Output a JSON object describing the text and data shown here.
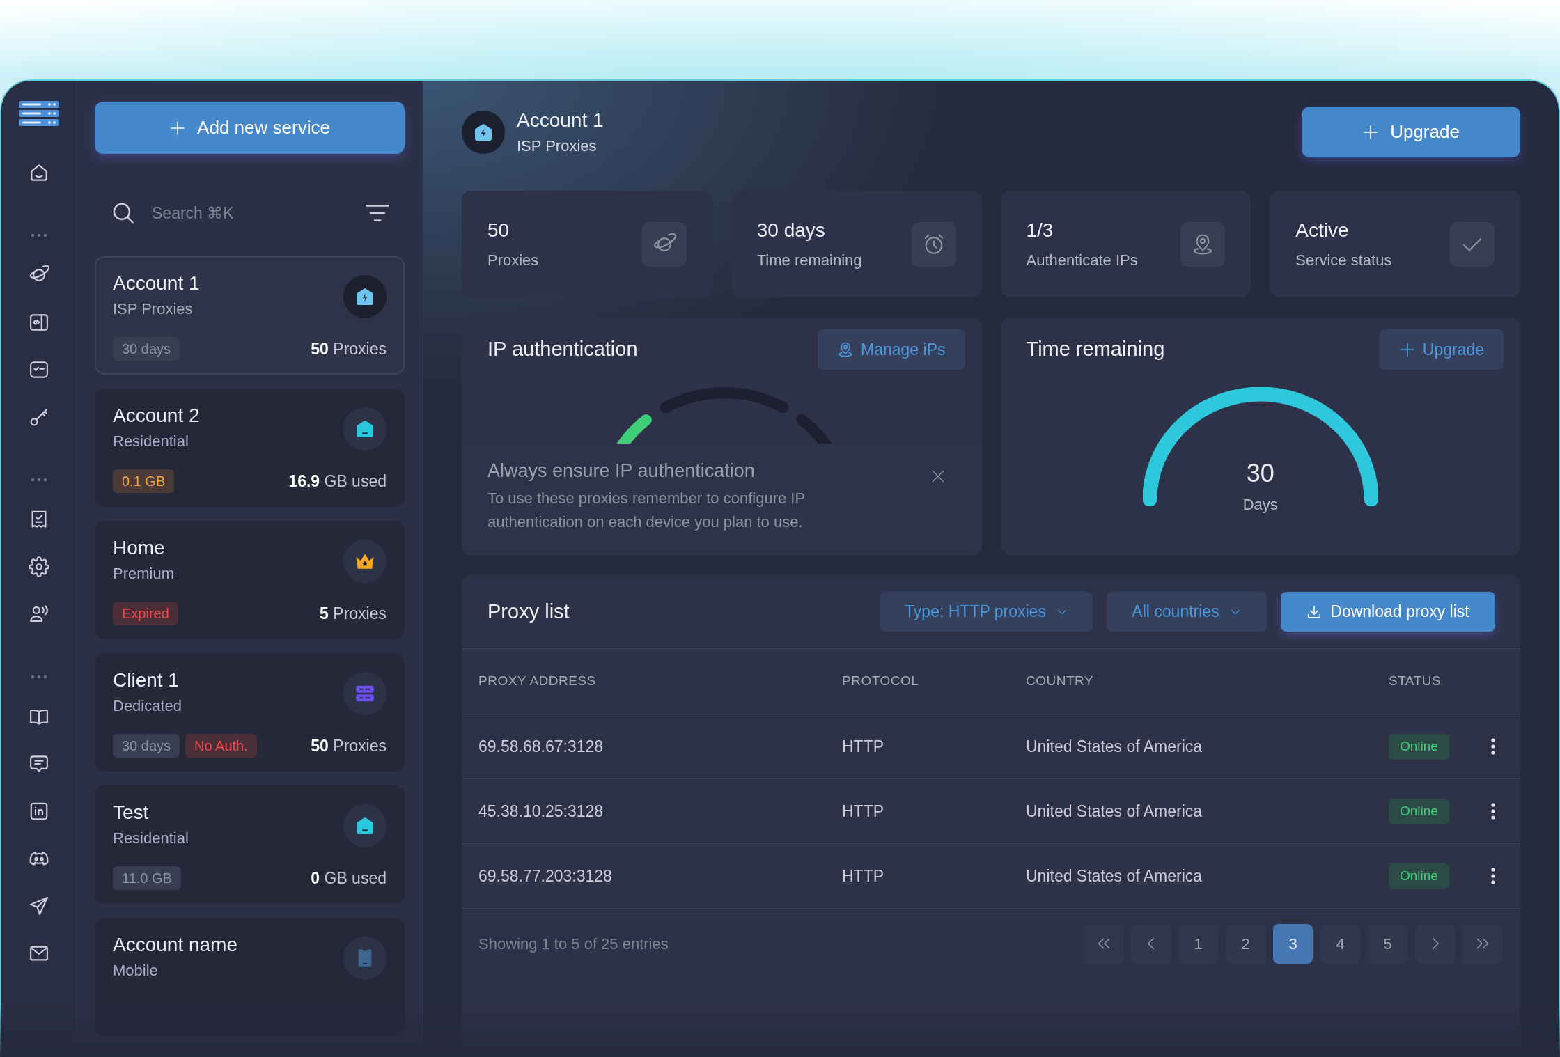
{
  "sidebar": {
    "add_button": {
      "label": "Add new service"
    },
    "search": {
      "placeholder": "Search ⌘K"
    },
    "services": [
      {
        "kind": "isp",
        "title": "Account 1",
        "subtitle": "ISP Proxies",
        "selected": true,
        "badges": [
          {
            "text": "30 days",
            "kind": "neutral"
          }
        ],
        "usage": "**50** Proxies"
      },
      {
        "kind": "residential",
        "title": "Account 2",
        "subtitle": "Residential",
        "selected": false,
        "badges": [
          {
            "text": "0.1 GB",
            "kind": "warning"
          }
        ],
        "usage": "**16.9** GB used"
      },
      {
        "kind": "premium",
        "title": "Home",
        "subtitle": "Premium",
        "selected": false,
        "badges": [
          {
            "text": "Expired",
            "kind": "danger"
          }
        ],
        "usage": "**5** Proxies"
      },
      {
        "kind": "dedicated",
        "title": "Client 1",
        "subtitle": "Dedicated",
        "selected": false,
        "badges": [
          {
            "text": "30 days",
            "kind": "neutral"
          },
          {
            "text": "No Auth.",
            "kind": "danger"
          }
        ],
        "usage": "**50** Proxies"
      },
      {
        "kind": "residential",
        "title": "Test",
        "subtitle": "Residential",
        "selected": false,
        "badges": [
          {
            "text": "11.0 GB",
            "kind": "neutral"
          }
        ],
        "usage": "**0** GB used"
      },
      {
        "kind": "mobile",
        "title": "Account name",
        "subtitle": "Mobile",
        "selected": false
      }
    ]
  },
  "header": {
    "kind": "isp",
    "title": "Account 1",
    "subtitle": "ISP Proxies",
    "upgrade_button": {
      "label": "Upgrade"
    }
  },
  "stats": [
    {
      "kind": "proxies",
      "value": "50",
      "label": "Proxies"
    },
    {
      "kind": "time",
      "value": "30 days",
      "label": "Time remaining"
    },
    {
      "kind": "ips",
      "value": "1/3",
      "label": "Authenticate IPs"
    },
    {
      "kind": "status",
      "value": "Active",
      "label": "Service status"
    }
  ],
  "ip_authentication": {
    "title": "IP authentication",
    "manage_button": {
      "label": "Manage iPs"
    },
    "notice": {
      "title": "Always ensure IP authentication",
      "text": "To use these proxies remember to configure IP authentication on each device you plan to use."
    }
  },
  "time_remaining": {
    "title": "Time remaining",
    "upgrade_button": {
      "label": "Upgrade"
    },
    "gauge": {
      "value": "30",
      "unit": "Days"
    }
  },
  "proxy_list": {
    "title": "Proxy list",
    "type_filter": {
      "label": "Type: HTTP proxies"
    },
    "country_filter": {
      "label": "All countries"
    },
    "download_button": {
      "label": "Download proxy list"
    },
    "table": {
      "columns": [
        "PROXY ADDRESS",
        "PROTOCOL",
        "COUNTRY",
        "STATUS"
      ],
      "rows": [
        {
          "proxy_address": "69.58.68.67:3128",
          "protocol": "HTTP",
          "country": "United States of America",
          "status": "Online"
        },
        {
          "proxy_address": "45.38.10.25:3128",
          "protocol": "HTTP",
          "country": "United States of America",
          "status": "Online"
        },
        {
          "proxy_address": "69.58.77.203:3128",
          "protocol": "HTTP",
          "country": "United States of America",
          "status": "Online"
        }
      ]
    },
    "footer": {
      "summary": "Showing 1 to 5 of 25 entries",
      "pages": [
        {
          "label": "1",
          "selected": false
        },
        {
          "label": "2",
          "selected": false
        },
        {
          "label": "3",
          "selected": true
        },
        {
          "label": "4",
          "selected": false
        },
        {
          "label": "5",
          "selected": false
        }
      ]
    }
  }
}
